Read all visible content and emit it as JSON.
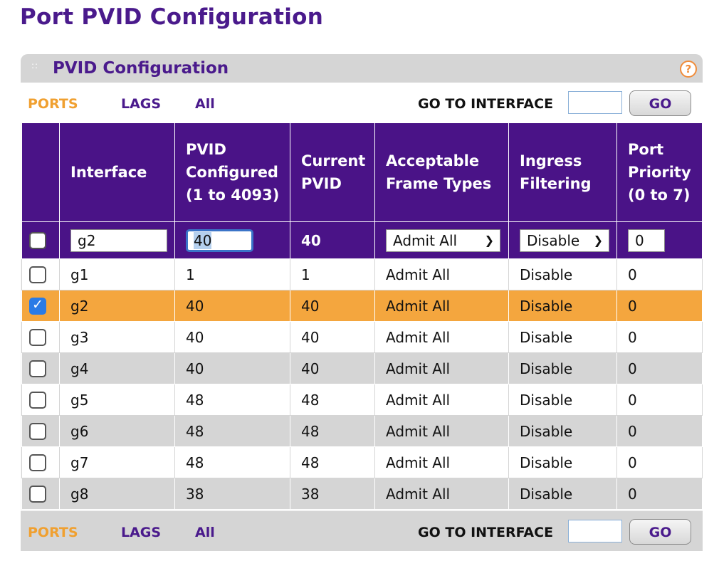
{
  "page": {
    "title": "Port PVID Configuration"
  },
  "panel": {
    "title": "PVID Configuration",
    "help_icon": "help-icon"
  },
  "toolbar": {
    "ports": "PORTS",
    "lags": "LAGS",
    "all": "All",
    "goto_label": "GO TO INTERFACE",
    "goto_value": "",
    "go_button": "GO"
  },
  "columns": {
    "interface": "Interface",
    "pvid_configured": "PVID Configured (1 to 4093)",
    "current_pvid": "Current PVID",
    "acceptable_frame_types": "Acceptable Frame Types",
    "ingress_filtering": "Ingress Filtering",
    "port_priority": "Port Priority (0 to 7)"
  },
  "edit_row": {
    "interface": "g2",
    "pvid_configured": "40",
    "current_pvid": "40",
    "acceptable_frame_types": "Admit All",
    "ingress_filtering": "Disable",
    "port_priority": "0"
  },
  "rows": [
    {
      "interface": "g1",
      "pvid_configured": "1",
      "current_pvid": "1",
      "acceptable_frame_types": "Admit All",
      "ingress_filtering": "Disable",
      "port_priority": "0",
      "checked": false
    },
    {
      "interface": "g2",
      "pvid_configured": "40",
      "current_pvid": "40",
      "acceptable_frame_types": "Admit All",
      "ingress_filtering": "Disable",
      "port_priority": "0",
      "checked": true
    },
    {
      "interface": "g3",
      "pvid_configured": "40",
      "current_pvid": "40",
      "acceptable_frame_types": "Admit All",
      "ingress_filtering": "Disable",
      "port_priority": "0",
      "checked": false
    },
    {
      "interface": "g4",
      "pvid_configured": "40",
      "current_pvid": "40",
      "acceptable_frame_types": "Admit All",
      "ingress_filtering": "Disable",
      "port_priority": "0",
      "checked": false
    },
    {
      "interface": "g5",
      "pvid_configured": "48",
      "current_pvid": "48",
      "acceptable_frame_types": "Admit All",
      "ingress_filtering": "Disable",
      "port_priority": "0",
      "checked": false
    },
    {
      "interface": "g6",
      "pvid_configured": "48",
      "current_pvid": "48",
      "acceptable_frame_types": "Admit All",
      "ingress_filtering": "Disable",
      "port_priority": "0",
      "checked": false
    },
    {
      "interface": "g7",
      "pvid_configured": "48",
      "current_pvid": "48",
      "acceptable_frame_types": "Admit All",
      "ingress_filtering": "Disable",
      "port_priority": "0",
      "checked": false
    },
    {
      "interface": "g8",
      "pvid_configured": "38",
      "current_pvid": "38",
      "acceptable_frame_types": "Admit All",
      "ingress_filtering": "Disable",
      "port_priority": "0",
      "checked": false
    }
  ],
  "colors": {
    "accent": "#4a1387",
    "active_tab": "#f0a030",
    "selected_row": "#f4a63e"
  }
}
